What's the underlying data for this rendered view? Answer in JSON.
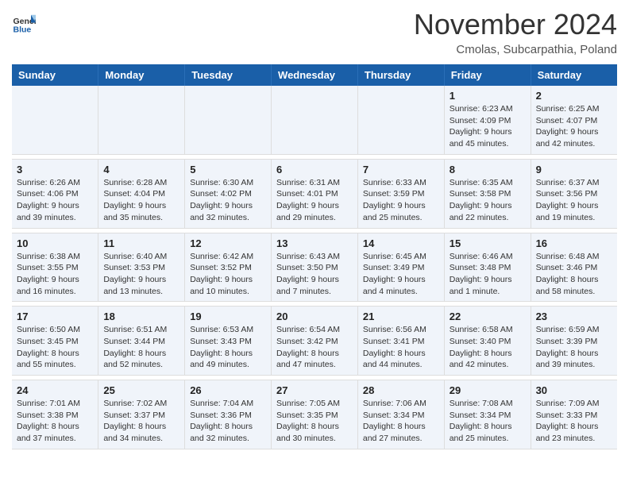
{
  "header": {
    "logo_text1": "General",
    "logo_text2": "Blue",
    "month": "November 2024",
    "location": "Cmolas, Subcarpathia, Poland"
  },
  "weekdays": [
    "Sunday",
    "Monday",
    "Tuesday",
    "Wednesday",
    "Thursday",
    "Friday",
    "Saturday"
  ],
  "weeks": [
    [
      {
        "day": "",
        "info": ""
      },
      {
        "day": "",
        "info": ""
      },
      {
        "day": "",
        "info": ""
      },
      {
        "day": "",
        "info": ""
      },
      {
        "day": "",
        "info": ""
      },
      {
        "day": "1",
        "info": "Sunrise: 6:23 AM\nSunset: 4:09 PM\nDaylight: 9 hours and 45 minutes."
      },
      {
        "day": "2",
        "info": "Sunrise: 6:25 AM\nSunset: 4:07 PM\nDaylight: 9 hours and 42 minutes."
      }
    ],
    [
      {
        "day": "3",
        "info": "Sunrise: 6:26 AM\nSunset: 4:06 PM\nDaylight: 9 hours and 39 minutes."
      },
      {
        "day": "4",
        "info": "Sunrise: 6:28 AM\nSunset: 4:04 PM\nDaylight: 9 hours and 35 minutes."
      },
      {
        "day": "5",
        "info": "Sunrise: 6:30 AM\nSunset: 4:02 PM\nDaylight: 9 hours and 32 minutes."
      },
      {
        "day": "6",
        "info": "Sunrise: 6:31 AM\nSunset: 4:01 PM\nDaylight: 9 hours and 29 minutes."
      },
      {
        "day": "7",
        "info": "Sunrise: 6:33 AM\nSunset: 3:59 PM\nDaylight: 9 hours and 25 minutes."
      },
      {
        "day": "8",
        "info": "Sunrise: 6:35 AM\nSunset: 3:58 PM\nDaylight: 9 hours and 22 minutes."
      },
      {
        "day": "9",
        "info": "Sunrise: 6:37 AM\nSunset: 3:56 PM\nDaylight: 9 hours and 19 minutes."
      }
    ],
    [
      {
        "day": "10",
        "info": "Sunrise: 6:38 AM\nSunset: 3:55 PM\nDaylight: 9 hours and 16 minutes."
      },
      {
        "day": "11",
        "info": "Sunrise: 6:40 AM\nSunset: 3:53 PM\nDaylight: 9 hours and 13 minutes."
      },
      {
        "day": "12",
        "info": "Sunrise: 6:42 AM\nSunset: 3:52 PM\nDaylight: 9 hours and 10 minutes."
      },
      {
        "day": "13",
        "info": "Sunrise: 6:43 AM\nSunset: 3:50 PM\nDaylight: 9 hours and 7 minutes."
      },
      {
        "day": "14",
        "info": "Sunrise: 6:45 AM\nSunset: 3:49 PM\nDaylight: 9 hours and 4 minutes."
      },
      {
        "day": "15",
        "info": "Sunrise: 6:46 AM\nSunset: 3:48 PM\nDaylight: 9 hours and 1 minute."
      },
      {
        "day": "16",
        "info": "Sunrise: 6:48 AM\nSunset: 3:46 PM\nDaylight: 8 hours and 58 minutes."
      }
    ],
    [
      {
        "day": "17",
        "info": "Sunrise: 6:50 AM\nSunset: 3:45 PM\nDaylight: 8 hours and 55 minutes."
      },
      {
        "day": "18",
        "info": "Sunrise: 6:51 AM\nSunset: 3:44 PM\nDaylight: 8 hours and 52 minutes."
      },
      {
        "day": "19",
        "info": "Sunrise: 6:53 AM\nSunset: 3:43 PM\nDaylight: 8 hours and 49 minutes."
      },
      {
        "day": "20",
        "info": "Sunrise: 6:54 AM\nSunset: 3:42 PM\nDaylight: 8 hours and 47 minutes."
      },
      {
        "day": "21",
        "info": "Sunrise: 6:56 AM\nSunset: 3:41 PM\nDaylight: 8 hours and 44 minutes."
      },
      {
        "day": "22",
        "info": "Sunrise: 6:58 AM\nSunset: 3:40 PM\nDaylight: 8 hours and 42 minutes."
      },
      {
        "day": "23",
        "info": "Sunrise: 6:59 AM\nSunset: 3:39 PM\nDaylight: 8 hours and 39 minutes."
      }
    ],
    [
      {
        "day": "24",
        "info": "Sunrise: 7:01 AM\nSunset: 3:38 PM\nDaylight: 8 hours and 37 minutes."
      },
      {
        "day": "25",
        "info": "Sunrise: 7:02 AM\nSunset: 3:37 PM\nDaylight: 8 hours and 34 minutes."
      },
      {
        "day": "26",
        "info": "Sunrise: 7:04 AM\nSunset: 3:36 PM\nDaylight: 8 hours and 32 minutes."
      },
      {
        "day": "27",
        "info": "Sunrise: 7:05 AM\nSunset: 3:35 PM\nDaylight: 8 hours and 30 minutes."
      },
      {
        "day": "28",
        "info": "Sunrise: 7:06 AM\nSunset: 3:34 PM\nDaylight: 8 hours and 27 minutes."
      },
      {
        "day": "29",
        "info": "Sunrise: 7:08 AM\nSunset: 3:34 PM\nDaylight: 8 hours and 25 minutes."
      },
      {
        "day": "30",
        "info": "Sunrise: 7:09 AM\nSunset: 3:33 PM\nDaylight: 8 hours and 23 minutes."
      }
    ]
  ]
}
